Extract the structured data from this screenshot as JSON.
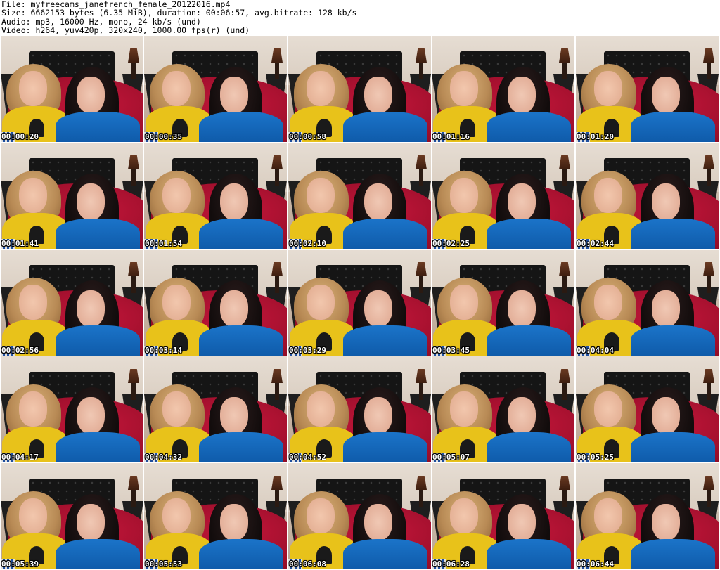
{
  "header": {
    "file_line": "File: myfreecams_janefrench_female_20122016.mp4",
    "size_line": "Size: 6662153 bytes (6.35 MiB), duration: 00:06:57, avg.bitrate: 128 kb/s",
    "audio_line": "Audio: mp3, 16000 Hz, mono, 24 kb/s (und)",
    "video_line": "Video: h264, yuv420p, 320x240, 1000.00 fps(r) (und)"
  },
  "thumbnails": [
    {
      "timestamp": "00:00:20"
    },
    {
      "timestamp": "00:00:35"
    },
    {
      "timestamp": "00:00:58"
    },
    {
      "timestamp": "00:01:16"
    },
    {
      "timestamp": "00:01:20"
    },
    {
      "timestamp": "00:01:41"
    },
    {
      "timestamp": "00:01:54"
    },
    {
      "timestamp": "00:02:10"
    },
    {
      "timestamp": "00:02:25"
    },
    {
      "timestamp": "00:02:44"
    },
    {
      "timestamp": "00:02:56"
    },
    {
      "timestamp": "00:03:14"
    },
    {
      "timestamp": "00:03:29"
    },
    {
      "timestamp": "00:03:45"
    },
    {
      "timestamp": "00:04:04"
    },
    {
      "timestamp": "00:04:17"
    },
    {
      "timestamp": "00:04:32"
    },
    {
      "timestamp": "00:04:52"
    },
    {
      "timestamp": "00:05:07"
    },
    {
      "timestamp": "00:05:25"
    },
    {
      "timestamp": "00:05:39"
    },
    {
      "timestamp": "00:05:53"
    },
    {
      "timestamp": "00:06:08"
    },
    {
      "timestamp": "00:06:28"
    },
    {
      "timestamp": "00:06:44"
    }
  ]
}
